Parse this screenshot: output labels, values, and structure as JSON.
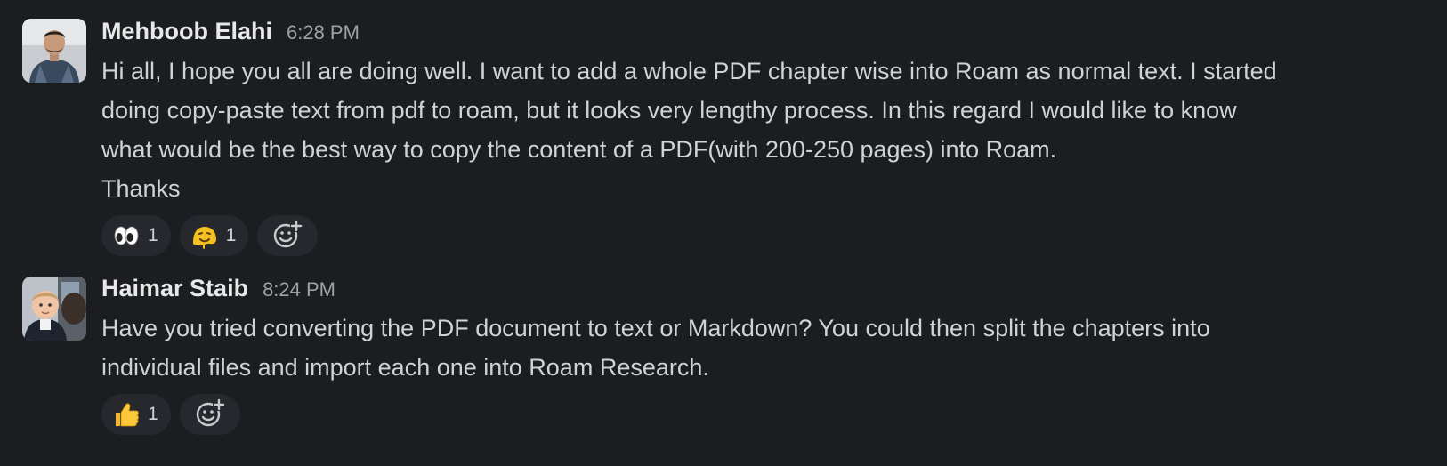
{
  "messages": [
    {
      "author": "Mehboob Elahi",
      "time": "6:28 PM",
      "lines": [
        "Hi all, I hope you all are doing well. I want to add a whole PDF chapter wise into Roam as normal text. I started",
        "doing copy-paste text from pdf to roam, but it looks very lengthy process. In this regard I would like to know",
        "what would be the best way to copy the content of a PDF(with 200-250 pages) into Roam.",
        "Thanks"
      ],
      "reactions": [
        {
          "emoji": "eyes-emoji",
          "count": "1"
        },
        {
          "emoji": "melting-face-emoji",
          "count": "1"
        }
      ]
    },
    {
      "author": "Haimar Staib",
      "time": "8:24 PM",
      "lines": [
        "Have you tried converting the PDF document to text or Markdown? You could then split the chapters into",
        "individual files and import each one into Roam Research."
      ],
      "reactions": [
        {
          "emoji": "thumbs-up-emoji",
          "count": "1"
        }
      ]
    }
  ],
  "colors": {
    "background": "#1b1d21",
    "reaction_bg": "#26282d",
    "text": "#d1d2d3",
    "author": "#e8e8e8",
    "timestamp": "#a0a1a3"
  }
}
